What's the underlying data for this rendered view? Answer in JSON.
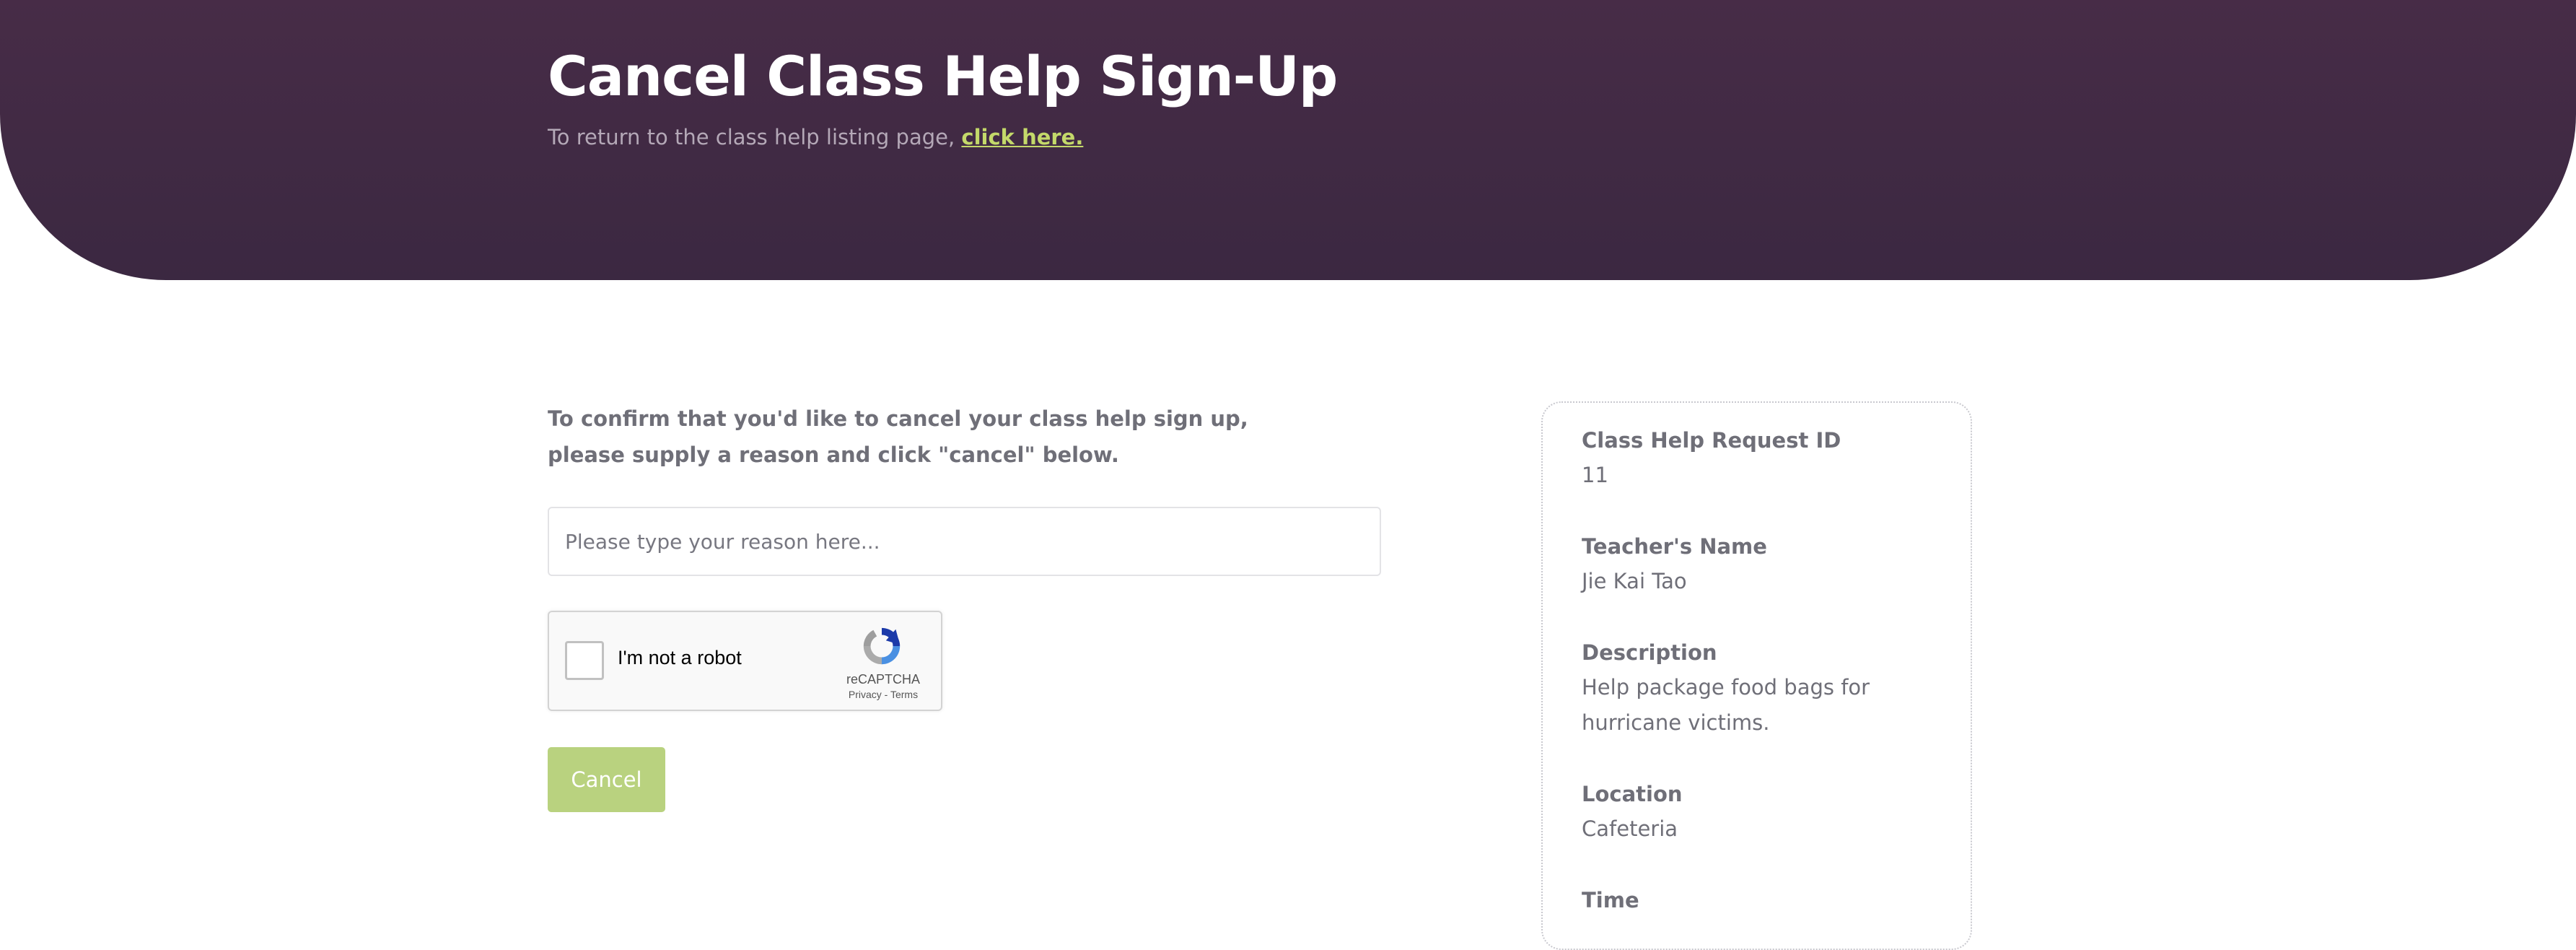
{
  "header": {
    "title": "Cancel Class Help Sign-Up",
    "subtitle_prefix": "To return to the class help listing page, ",
    "subtitle_link": "click here.",
    "background_color": "#3f2a43",
    "link_color": "#c4d96a"
  },
  "form": {
    "instructions": "To confirm that you'd like to cancel your class help sign up, please supply a reason and click \"cancel\" below.",
    "reason_placeholder": "Please type your reason here...",
    "reason_value": "",
    "cancel_label": "Cancel",
    "cancel_color": "#b9d27f"
  },
  "captcha": {
    "label": "I'm not a robot",
    "brand": "reCAPTCHA",
    "privacy": "Privacy",
    "separator": "-",
    "terms": "Terms",
    "checked": false,
    "icon": "recaptcha-logo-icon"
  },
  "details": {
    "request_id_label": "Class Help Request ID",
    "request_id_value": "11",
    "teacher_label": "Teacher's Name",
    "teacher_value": "Jie Kai Tao",
    "description_label": "Description",
    "description_value": "Help package food bags for hurricane victims.",
    "location_label": "Location",
    "location_value": "Cafeteria",
    "time_label": "Time"
  }
}
